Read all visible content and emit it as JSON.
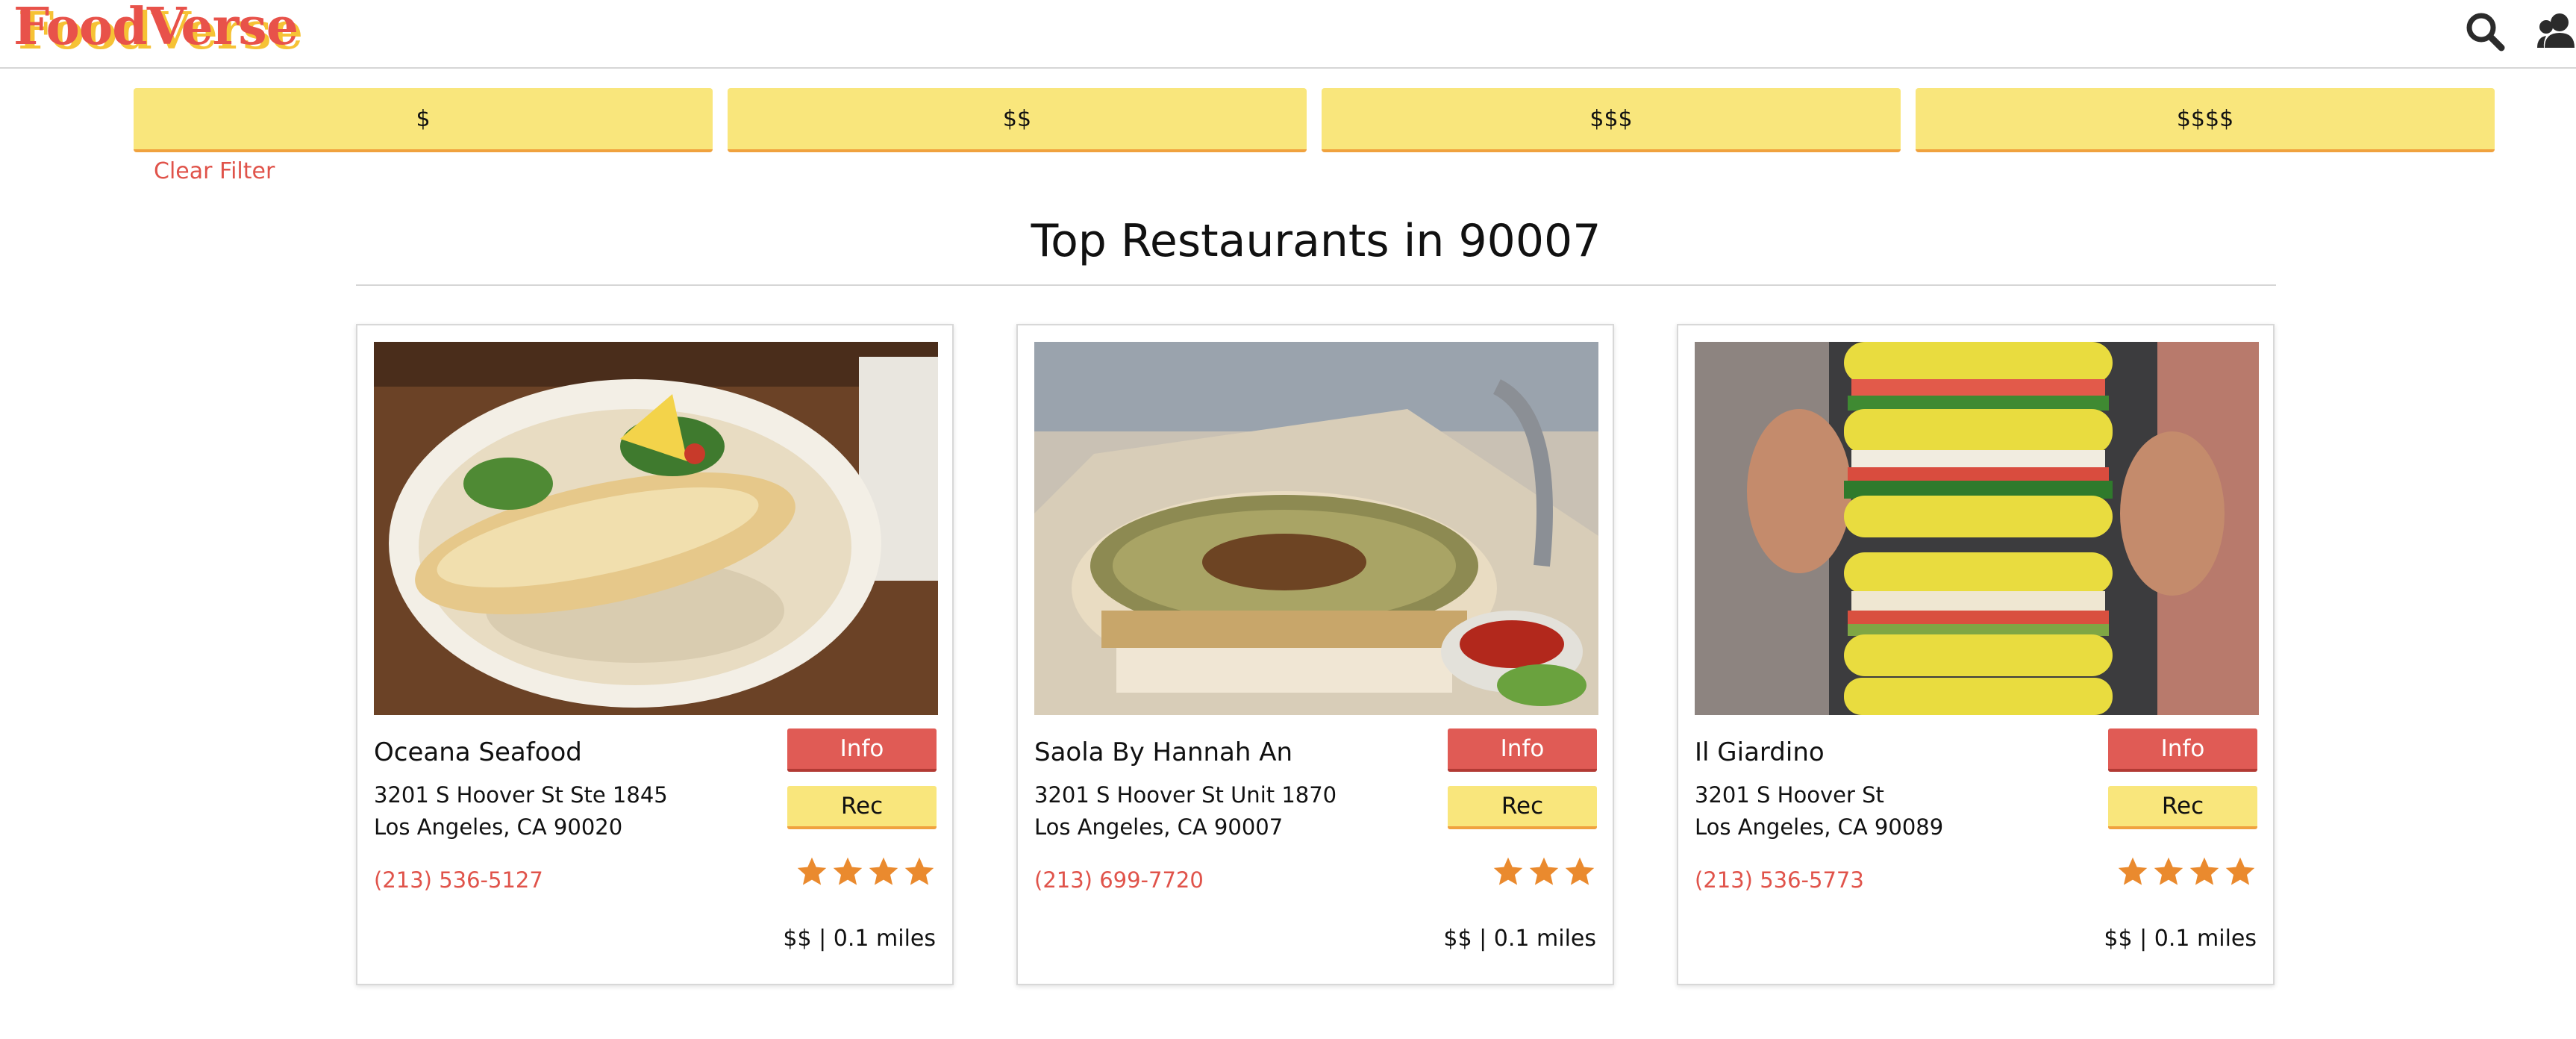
{
  "header": {
    "logo": "FoodVerse",
    "icons": [
      "search-icon",
      "users-icon"
    ]
  },
  "filters": {
    "options": [
      "$",
      "$$",
      "$$$",
      "$$$$"
    ],
    "clear_label": "Clear Filter"
  },
  "main": {
    "title": "Top Restaurants in 90007"
  },
  "restaurants": [
    {
      "name": "Oceana Seafood",
      "address_line1": "3201 S Hoover St Ste 1845",
      "address_line2": "Los Angeles, CA 90020",
      "phone": "(213) 536-5127",
      "rating": 4,
      "meta": "$$ | 0.1 miles",
      "info_label": "Info",
      "rec_label": "Rec",
      "image": "fish-rice-bowl"
    },
    {
      "name": "Saola By Hannah An",
      "address_line1": "3201 S Hoover St Unit 1870",
      "address_line2": "Los Angeles, CA 90007",
      "phone": "(213) 699-7720",
      "rating": 3,
      "meta": "$$ | 0.1 miles",
      "info_label": "Info",
      "rec_label": "Rec",
      "image": "pho-bowl"
    },
    {
      "name": "Il Giardino",
      "address_line1": "3201 S Hoover St",
      "address_line2": "Los Angeles, CA 90089",
      "phone": "(213) 536-5773",
      "rating": 4,
      "meta": "$$ | 0.1 miles",
      "info_label": "Info",
      "rec_label": "Rec",
      "image": "sandwich-stack"
    }
  ],
  "colors": {
    "accent_red": "#e05b55",
    "button_yellow": "#f9e67c",
    "star_orange": "#ea8a2e",
    "logo_red": "#e8524a",
    "logo_yellow": "#f6c235"
  }
}
